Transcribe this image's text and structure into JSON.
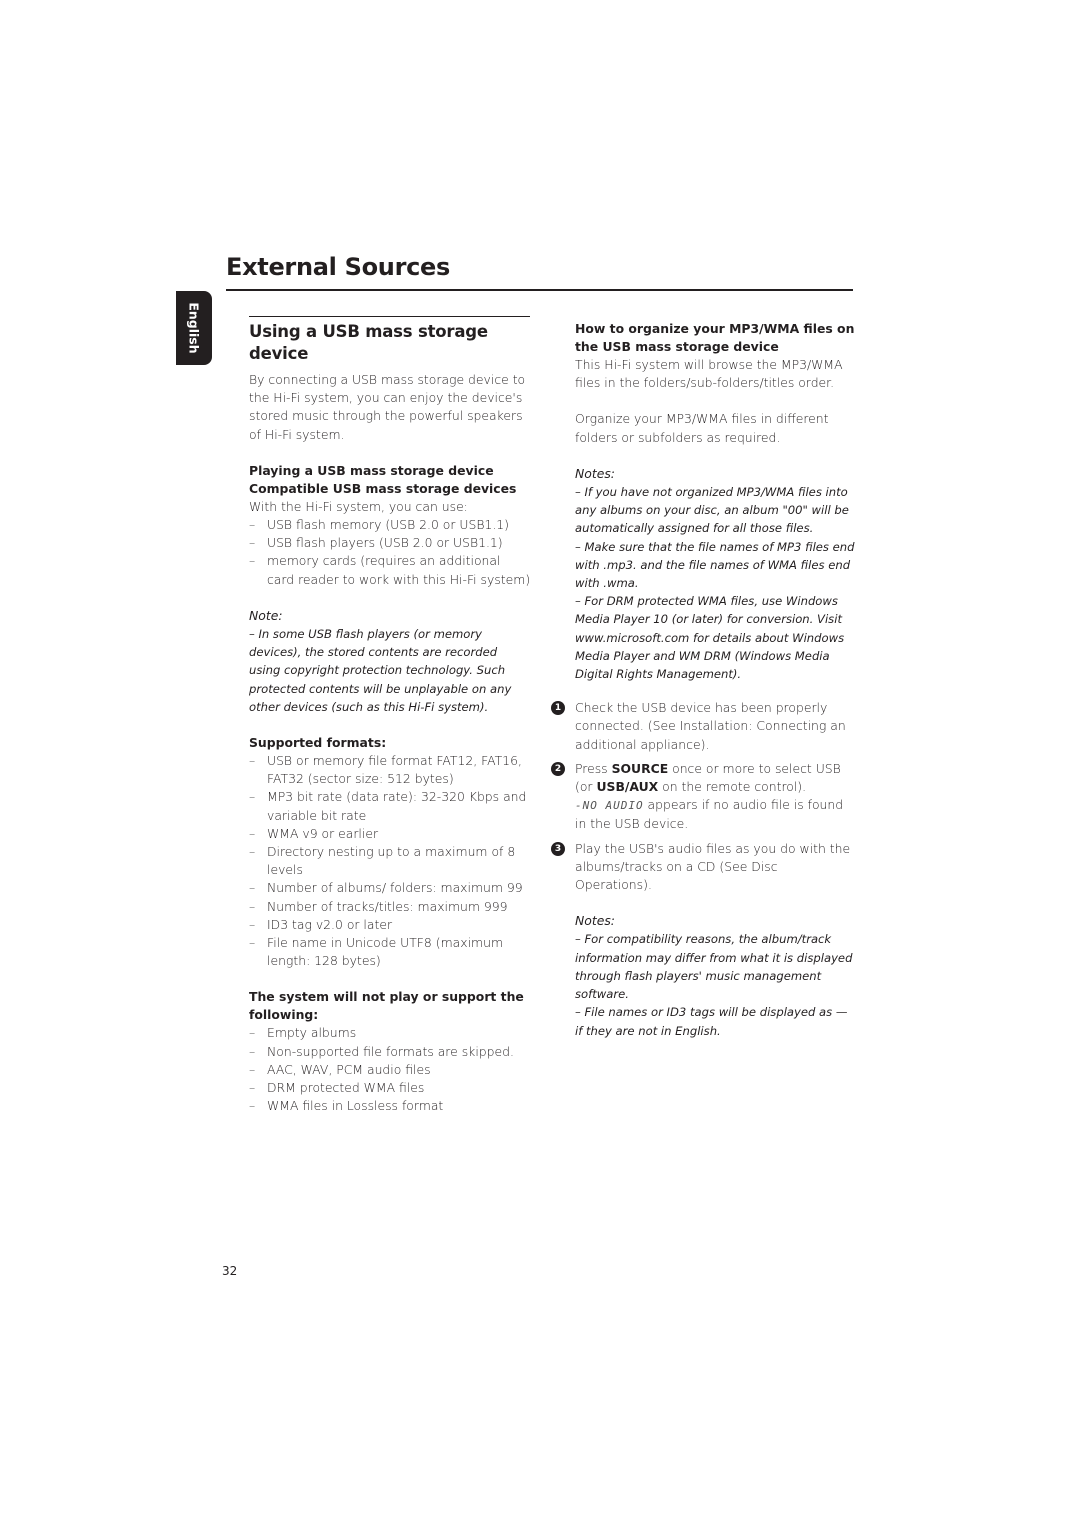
{
  "page": {
    "title": "External Sources",
    "language_tab": "English",
    "page_number": "32"
  },
  "left": {
    "heading": "Using a USB mass storage device",
    "intro": "By connecting a USB mass storage device to the Hi-Fi system, you can enjoy the device's stored music through the powerful speakers of Hi-Fi system.",
    "playing_heading": "Playing a USB mass storage device",
    "compatible_heading": "Compatible USB mass storage devices",
    "compatible_intro": "With the Hi-Fi system, you can use:",
    "compatible_items": [
      "USB flash memory (USB 2.0 or USB1.1)",
      "USB flash players (USB 2.0 or USB1.1)",
      "memory cards (requires an additional card reader to work with this Hi-Fi system)"
    ],
    "note_label": "Note:",
    "note_text": "–  In some USB flash players (or memory devices), the stored contents are recorded using copyright protection technology. Such protected contents will be unplayable on any other devices (such as this Hi-Fi system).",
    "formats_heading": "Supported formats:",
    "formats_items": [
      "USB or memory file format FAT12, FAT16, FAT32 (sector size: 512 bytes)",
      "MP3 bit rate (data rate): 32-320 Kbps and variable bit rate",
      "WMA v9 or earlier",
      "Directory nesting up to a maximum of 8 levels",
      "Number of albums/ folders: maximum 99",
      "Number of tracks/titles: maximum 999",
      "ID3 tag v2.0 or later",
      "File name in Unicode UTF8 (maximum length: 128 bytes)"
    ],
    "unsupported_heading": "The system will not play or support the following:",
    "unsupported_items": [
      "Empty albums",
      "Non-supported file formats are skipped.",
      "AAC, WAV, PCM audio files",
      "DRM protected WMA files",
      "WMA files in Lossless format"
    ]
  },
  "right": {
    "organize_heading": "How to organize your MP3/WMA files on the USB mass storage device",
    "organize_p1": "This Hi-Fi system will browse the MP3/WMA files in the folders/sub-folders/titles order.",
    "organize_p2": "Organize your MP3/WMA files in different folders or subfolders as required.",
    "notes1_label": "Notes:",
    "notes1": [
      "–  If you have not organized MP3/WMA files into any albums on your disc, an album \"00\" will be automatically assigned for all those files.",
      "–  Make sure that the file names of MP3 files end with .mp3. and the file names of WMA files end with .wma.",
      "–  For DRM protected WMA files, use Windows Media Player 10 (or later) for conversion. Visit www.microsoft.com for details about Windows Media Player and WM DRM (Windows Media Digital Rights Management)."
    ],
    "steps": [
      {
        "number": "1",
        "text": "Check the USB device has been properly connected. (See Installation: Connecting an additional appliance)."
      },
      {
        "number": "2",
        "pre": "Press ",
        "key1": "SOURCE",
        "mid": " once or more to select USB (or ",
        "key2": "USB/AUX",
        "post": " on the remote control).",
        "lcd": "-NO AUDIO",
        "lcd_post": " appears if no audio file is found in the USB device."
      },
      {
        "number": "3",
        "text": "Play the USB's audio files as you do with the albums/tracks on a CD (See Disc Operations)."
      }
    ],
    "notes2_label": "Notes:",
    "notes2": [
      "–  For compatibility reasons, the album/track information may differ from what it is displayed through flash players' music management software.",
      "–  File names or ID3 tags will be displayed as — if they are not in English."
    ]
  }
}
